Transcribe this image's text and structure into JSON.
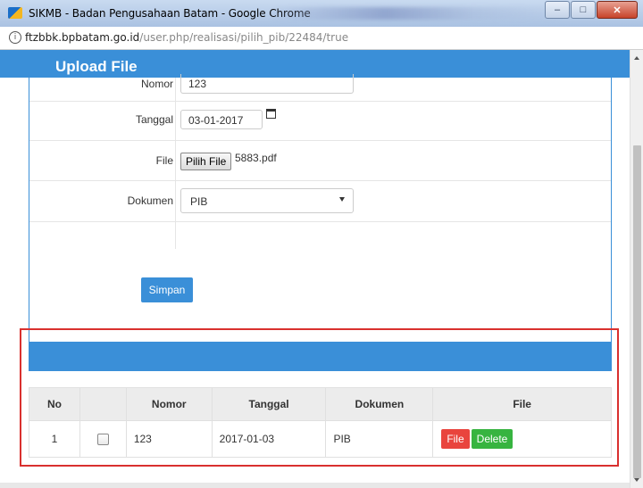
{
  "window": {
    "title": "SIKMB - Badan Pengusahaan Batam - Google Chrome"
  },
  "address": {
    "host": "ftzbbk.bpbatam.go.id",
    "path": "/user.php/realisasi/pilih_pib/22484/true"
  },
  "modal": {
    "title": "Upload File"
  },
  "form": {
    "nomor_label": "Nomor",
    "nomor_value": "123",
    "tanggal_label": "Tanggal",
    "tanggal_value": "03-01-2017",
    "file_label": "File",
    "file_button": "Pilih File",
    "file_name": "5883.pdf",
    "dokumen_label": "Dokumen",
    "dokumen_value": "PIB",
    "submit_label": "Simpan"
  },
  "table": {
    "headers": [
      "No",
      "",
      "Nomor",
      "Tanggal",
      "Dokumen",
      "File"
    ],
    "rows": [
      {
        "no": "1",
        "nomor": "123",
        "tanggal": "2017-01-03",
        "dokumen": "PIB",
        "file_btn": "File",
        "delete_btn": "Delete"
      }
    ]
  },
  "colors": {
    "primary": "#3a8fd8",
    "danger": "#e9443d",
    "success": "#37b440",
    "highlight_frame": "#d9302e"
  },
  "icons": [
    "app-icon",
    "info-icon",
    "calendar-icon",
    "chevron-down-icon"
  ]
}
